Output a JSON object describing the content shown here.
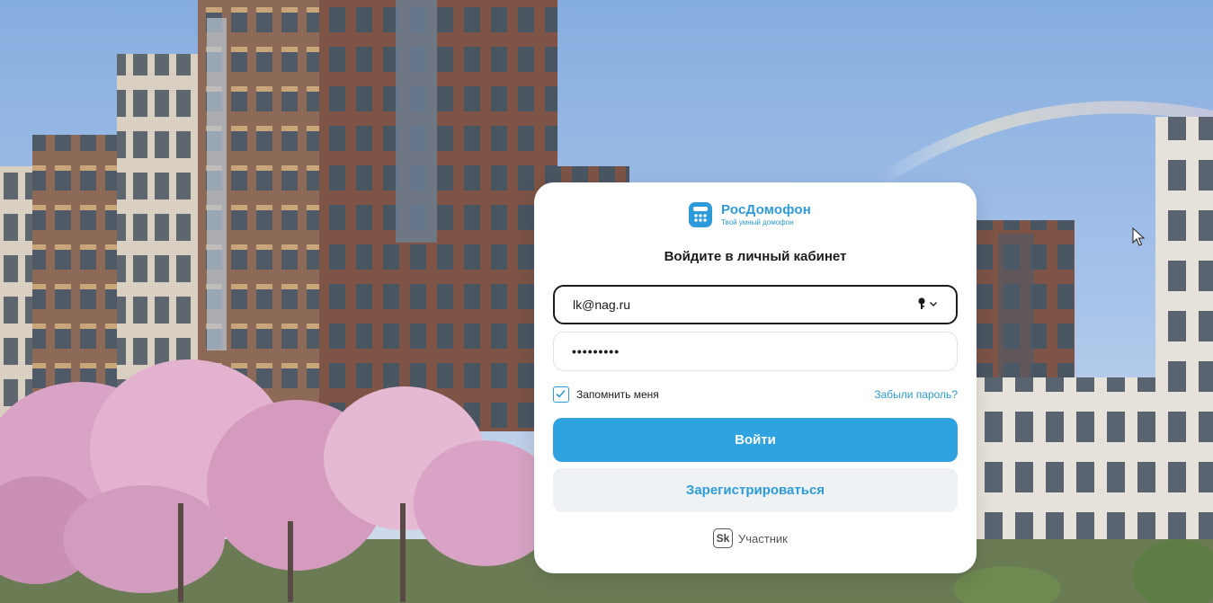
{
  "logo": {
    "name": "РосДомофон",
    "tagline": "Твой умный домофон"
  },
  "form": {
    "title": "Войдите в личный кабинет",
    "email_value": "lk@nag.ru",
    "password_value": "•••••••••",
    "remember_label": "Запомнить меня",
    "remember_checked": true,
    "forgot_label": "Забыли пароль?",
    "login_label": "Войти",
    "register_label": "Зарегистрироваться"
  },
  "footer": {
    "badge_mark": "Sk",
    "badge_label": "Участник"
  },
  "icons": {
    "password_manager": "key-icon",
    "dropdown": "chevron-down-icon",
    "checkbox": "check-icon",
    "cursor": "mouse-pointer-icon"
  },
  "colors": {
    "accent": "#2ea3df",
    "accent_text": "#2d9bd9",
    "register_bg": "#eef2f5"
  }
}
